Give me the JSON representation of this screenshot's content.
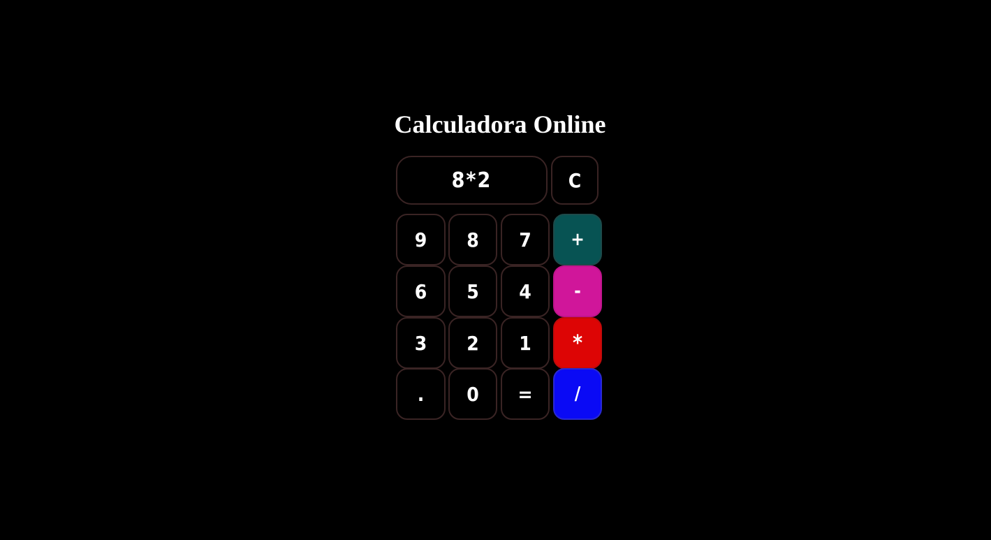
{
  "title": "Calculadora Online",
  "display": {
    "value": "8*2"
  },
  "clear_label": "C",
  "keys": {
    "k9": "9",
    "k8": "8",
    "k7": "7",
    "plus": "+",
    "k6": "6",
    "k5": "5",
    "k4": "4",
    "minus": "-",
    "k3": "3",
    "k2": "2",
    "k1": "1",
    "times": "*",
    "dot": ".",
    "k0": "0",
    "equals": "=",
    "divide": "/"
  },
  "colors": {
    "background": "#000000",
    "plus": "#075353",
    "minus": "#d0169a",
    "times": "#dd0505",
    "divide": "#0a0af5"
  }
}
